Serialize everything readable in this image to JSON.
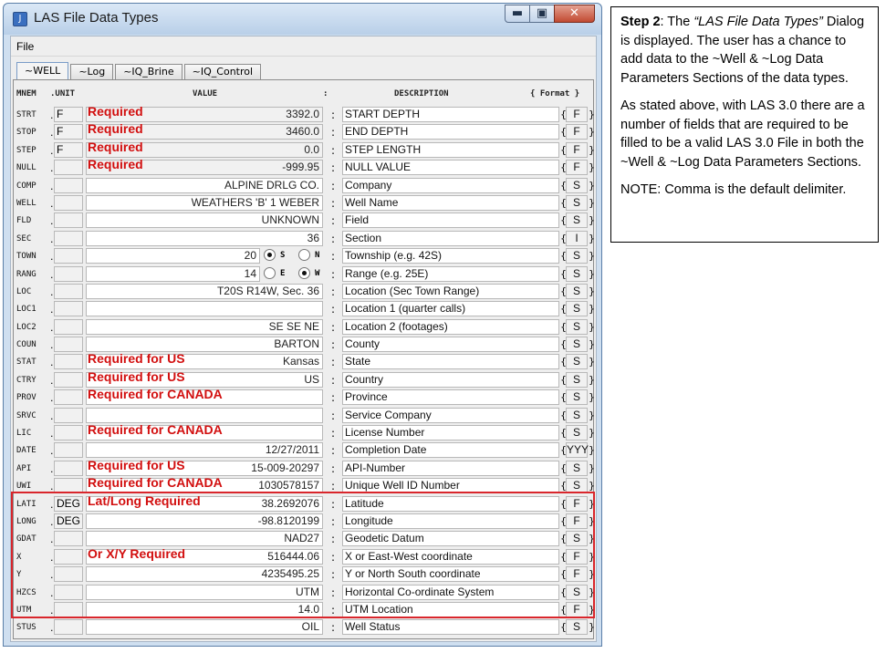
{
  "window": {
    "title": "LAS File Data Types",
    "buttons": {
      "minimize": "▬",
      "maximize": "▣",
      "close": "✕"
    }
  },
  "menu": {
    "file": "File"
  },
  "tabs": [
    {
      "label": "~WELL",
      "active": true
    },
    {
      "label": "~Log",
      "active": false
    },
    {
      "label": "~IQ_Brine",
      "active": false
    },
    {
      "label": "~IQ_Control",
      "active": false
    }
  ],
  "header": {
    "mnem": "MNEM",
    "unit": ".UNIT",
    "value": "VALUE",
    "colon": ":",
    "description": "DESCRIPTION",
    "format": "{ Format }"
  },
  "radio_labels": {
    "s": "S",
    "n": "N",
    "e": "E",
    "w": "W"
  },
  "rows": [
    {
      "mnem": "STRT",
      "unit": "F",
      "value": "3392.0",
      "desc": "START DEPTH",
      "fmt": "F",
      "req": "Required"
    },
    {
      "mnem": "STOP",
      "unit": "F",
      "value": "3460.0",
      "desc": "END DEPTH",
      "fmt": "F",
      "req": "Required"
    },
    {
      "mnem": "STEP",
      "unit": "F",
      "value": "0.0",
      "desc": "STEP LENGTH",
      "fmt": "F",
      "req": "Required"
    },
    {
      "mnem": "NULL",
      "unit": "",
      "value": "-999.95",
      "desc": "NULL VALUE",
      "fmt": "F",
      "req": "Required"
    },
    {
      "mnem": "COMP",
      "unit": "",
      "value": "ALPINE DRLG CO.",
      "desc": "Company",
      "fmt": "S",
      "req": ""
    },
    {
      "mnem": "WELL",
      "unit": "",
      "value": "WEATHERS 'B' 1 WEBER",
      "desc": "Well Name",
      "fmt": "S",
      "req": ""
    },
    {
      "mnem": "FLD",
      "unit": "",
      "value": "UNKNOWN",
      "desc": "Field",
      "fmt": "S",
      "req": ""
    },
    {
      "mnem": "SEC",
      "unit": "",
      "value": "36",
      "desc": "Section",
      "fmt": "I",
      "req": ""
    },
    {
      "mnem": "TOWN",
      "unit": "",
      "value": "20",
      "desc": "Township (e.g. 42S)",
      "fmt": "S",
      "req": "",
      "radio": "SN",
      "selected": "S"
    },
    {
      "mnem": "RANG",
      "unit": "",
      "value": "14",
      "desc": "Range  (e.g. 25E)",
      "fmt": "S",
      "req": "",
      "radio": "EW",
      "selected": "W"
    },
    {
      "mnem": "LOC",
      "unit": "",
      "value": "T20S R14W, Sec. 36",
      "desc": "Location (Sec Town Range)",
      "fmt": "S",
      "req": ""
    },
    {
      "mnem": "LOC1",
      "unit": "",
      "value": "",
      "desc": "Location 1 (quarter calls)",
      "fmt": "S",
      "req": ""
    },
    {
      "mnem": "LOC2",
      "unit": "",
      "value": "SE SE NE",
      "desc": "Location 2 (footages)",
      "fmt": "S",
      "req": ""
    },
    {
      "mnem": "COUN",
      "unit": "",
      "value": "BARTON",
      "desc": "County",
      "fmt": "S",
      "req": ""
    },
    {
      "mnem": "STAT",
      "unit": "",
      "value": "Kansas",
      "desc": "State",
      "fmt": "S",
      "req": "Required for US"
    },
    {
      "mnem": "CTRY",
      "unit": "",
      "value": "US",
      "desc": "Country",
      "fmt": "S",
      "req": "Required for US"
    },
    {
      "mnem": "PROV",
      "unit": "",
      "value": "",
      "desc": "Province",
      "fmt": "S",
      "req": "Required for CANADA"
    },
    {
      "mnem": "SRVC",
      "unit": "",
      "value": "",
      "desc": "Service Company",
      "fmt": "S",
      "req": ""
    },
    {
      "mnem": "LIC",
      "unit": "",
      "value": "",
      "desc": "License Number",
      "fmt": "S",
      "req": "Required for CANADA"
    },
    {
      "mnem": "DATE",
      "unit": "",
      "value": "12/27/2011",
      "desc": "Completion Date",
      "fmt": "YYY",
      "req": ""
    },
    {
      "mnem": "API",
      "unit": "",
      "value": "15-009-20297",
      "desc": "API-Number",
      "fmt": "S",
      "req": "Required for US"
    },
    {
      "mnem": "UWI",
      "unit": "",
      "value": "1030578157",
      "desc": "Unique Well ID Number",
      "fmt": "S",
      "req": "Required for CANADA"
    },
    {
      "mnem": "LATI",
      "unit": "DEG",
      "value": "38.2692076",
      "desc": "Latitude",
      "fmt": "F",
      "req": "Lat/Long Required"
    },
    {
      "mnem": "LONG",
      "unit": "DEG",
      "value": "-98.8120199",
      "desc": "Longitude",
      "fmt": "F",
      "req": ""
    },
    {
      "mnem": "GDAT",
      "unit": "",
      "value": "NAD27",
      "desc": "Geodetic Datum",
      "fmt": "S",
      "req": ""
    },
    {
      "mnem": "X",
      "unit": "",
      "value": "516444.06",
      "desc": "X or East-West coordinate",
      "fmt": "F",
      "req": "Or X/Y Required"
    },
    {
      "mnem": "Y",
      "unit": "",
      "value": "4235495.25",
      "desc": "Y or North South coordinate",
      "fmt": "F",
      "req": ""
    },
    {
      "mnem": "HZCS",
      "unit": "",
      "value": "UTM",
      "desc": "Horizontal Co-ordinate System",
      "fmt": "S",
      "req": ""
    },
    {
      "mnem": "UTM",
      "unit": "",
      "value": "14.0",
      "desc": "UTM Location",
      "fmt": "F",
      "req": ""
    },
    {
      "mnem": "STUS",
      "unit": "",
      "value": "OIL",
      "desc": "Well Status",
      "fmt": "S",
      "req": ""
    }
  ],
  "note": {
    "step_label": "Step 2",
    "step_text_1": ": The ",
    "step_title": "“LAS File Data Types”",
    "step_text_2": " Dialog is displayed.  The user has a chance to add data to the ~Well & ~Log Data Parameters Sections of the data types.",
    "para2": "As stated above, with LAS 3.0 there are a number of fields that are required to be filled to be a valid LAS 3.0 File in both the ~Well & ~Log Data Parameters Sections.",
    "para3": "NOTE: Comma is the default delimiter."
  },
  "colors": {
    "required_text": "#d20f0f",
    "highlight_box": "#d9262c"
  }
}
